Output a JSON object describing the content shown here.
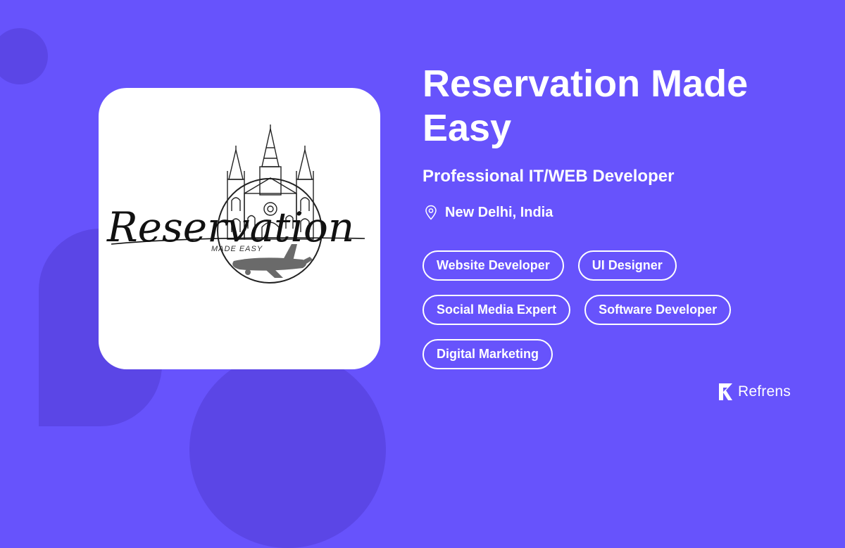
{
  "logo": {
    "script_text": "Reservation",
    "tagline": "MADE EASY"
  },
  "profile": {
    "name": "Reservation Made Easy",
    "headline": "Professional IT/WEB Developer",
    "location": "New Delhi, India",
    "location_icon": "map-pin-icon"
  },
  "tags": [
    "Website Developer",
    "UI Designer",
    "Social Media Expert",
    "Software Developer",
    "Digital Marketing"
  ],
  "brand": {
    "name": "Refrens",
    "icon": "refrens-logo-icon"
  },
  "colors": {
    "background": "#6753fc",
    "decoration": "#5b46e6",
    "card": "#ffffff",
    "text": "#ffffff"
  }
}
